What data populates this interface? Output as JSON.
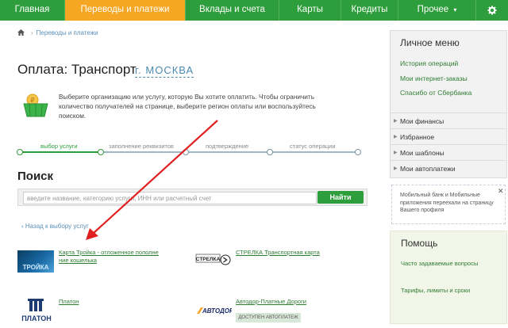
{
  "nav": {
    "items": [
      "Главная",
      "Переводы и платежи",
      "Вклады и счета",
      "Карты",
      "Кредиты",
      "Прочее"
    ],
    "active_index": 1,
    "more_icon": "chevron-down",
    "settings_icon": "gear-icon"
  },
  "breadcrumb": {
    "home_icon": "home-icon",
    "link": "Переводы и платежи"
  },
  "page": {
    "title": "Оплата: Транспорт",
    "city": "г. МОСКВА"
  },
  "intro": "Выберите организацию или услугу, которую Вы хотите оплатить. Чтобы ограничить количество получателей на странице, выберите регион оплаты или воспользуйтесь поиском.",
  "steps": [
    "выбор услуги",
    "заполнение реквизитов",
    "подтверждение",
    "статус операции"
  ],
  "search": {
    "heading": "Поиск",
    "placeholder": "введите название, категорию услуги, ИНН или расчетный счет",
    "button": "Найти"
  },
  "back_link": "Назад к выбору услуг",
  "services": [
    {
      "name": "Карта Тройка - отложенное пополне ние кошелька",
      "logo": "ТРОЙКА"
    },
    {
      "name": "СТРЕЛКА Транспортная карта",
      "logo": "СТРЕЛКА"
    },
    {
      "name": "Платон",
      "logo": "ПЛАТОН"
    },
    {
      "name": "Автодор-Платные Дороги",
      "logo": "АВТОДОР",
      "badge": "ДОСТУПЕН АВТОПЛАТЕЖ"
    }
  ],
  "menu": {
    "title": "Личное меню",
    "links": [
      "История операций",
      "Мои интернет-заказы",
      "Спасибо от Сбербанка"
    ],
    "sections": [
      "Мои финансы",
      "Избранное",
      "Мои шаблоны",
      "Мои автоплатежи"
    ]
  },
  "promo": {
    "text": "Мобильный банк и Мобильные приложения переехали на страницу Вашего профиля"
  },
  "help": {
    "title": "Помощь",
    "links": [
      "Часто задаваемые вопросы",
      "Тарифы, лимиты и сроки"
    ]
  },
  "colors": {
    "brand_green": "#2e9e3c",
    "active_tab": "#f5a623",
    "link": "#2e7d32",
    "annotation_arrow": "#e02020"
  }
}
